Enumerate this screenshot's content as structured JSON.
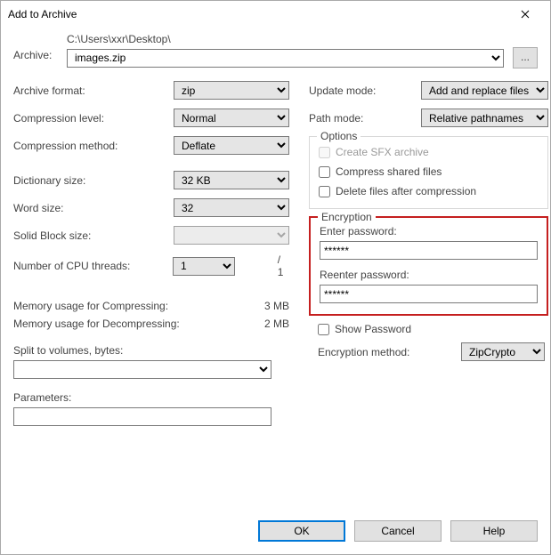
{
  "window": {
    "title": "Add to Archive"
  },
  "archive": {
    "label": "Archive:",
    "path": "C:\\Users\\xxr\\Desktop\\",
    "filename": "images.zip",
    "browse": "..."
  },
  "left": {
    "format_label": "Archive format:",
    "format_value": "zip",
    "level_label": "Compression level:",
    "level_value": "Normal",
    "method_label": "Compression method:",
    "method_value": "Deflate",
    "dict_label": "Dictionary size:",
    "dict_value": "32 KB",
    "word_label": "Word size:",
    "word_value": "32",
    "solid_label": "Solid Block size:",
    "solid_value": "",
    "cpu_label": "Number of CPU threads:",
    "cpu_value": "1",
    "cpu_total": "/ 1",
    "mem_comp_label": "Memory usage for Compressing:",
    "mem_comp_value": "3 MB",
    "mem_decomp_label": "Memory usage for Decompressing:",
    "mem_decomp_value": "2 MB",
    "split_label": "Split to volumes, bytes:",
    "split_value": "",
    "param_label": "Parameters:",
    "param_value": ""
  },
  "right": {
    "update_label": "Update mode:",
    "update_value": "Add and replace files",
    "path_label": "Path mode:",
    "path_value": "Relative pathnames",
    "options_legend": "Options",
    "sfx_label": "Create SFX archive",
    "compress_shared_label": "Compress shared files",
    "delete_after_label": "Delete files after compression",
    "enc_legend": "Encryption",
    "enter_pw_label": "Enter password:",
    "enter_pw_value": "******",
    "reenter_pw_label": "Reenter password:",
    "reenter_pw_value": "******",
    "show_pw_label": "Show Password",
    "enc_method_label": "Encryption method:",
    "enc_method_value": "ZipCrypto"
  },
  "buttons": {
    "ok": "OK",
    "cancel": "Cancel",
    "help": "Help"
  }
}
